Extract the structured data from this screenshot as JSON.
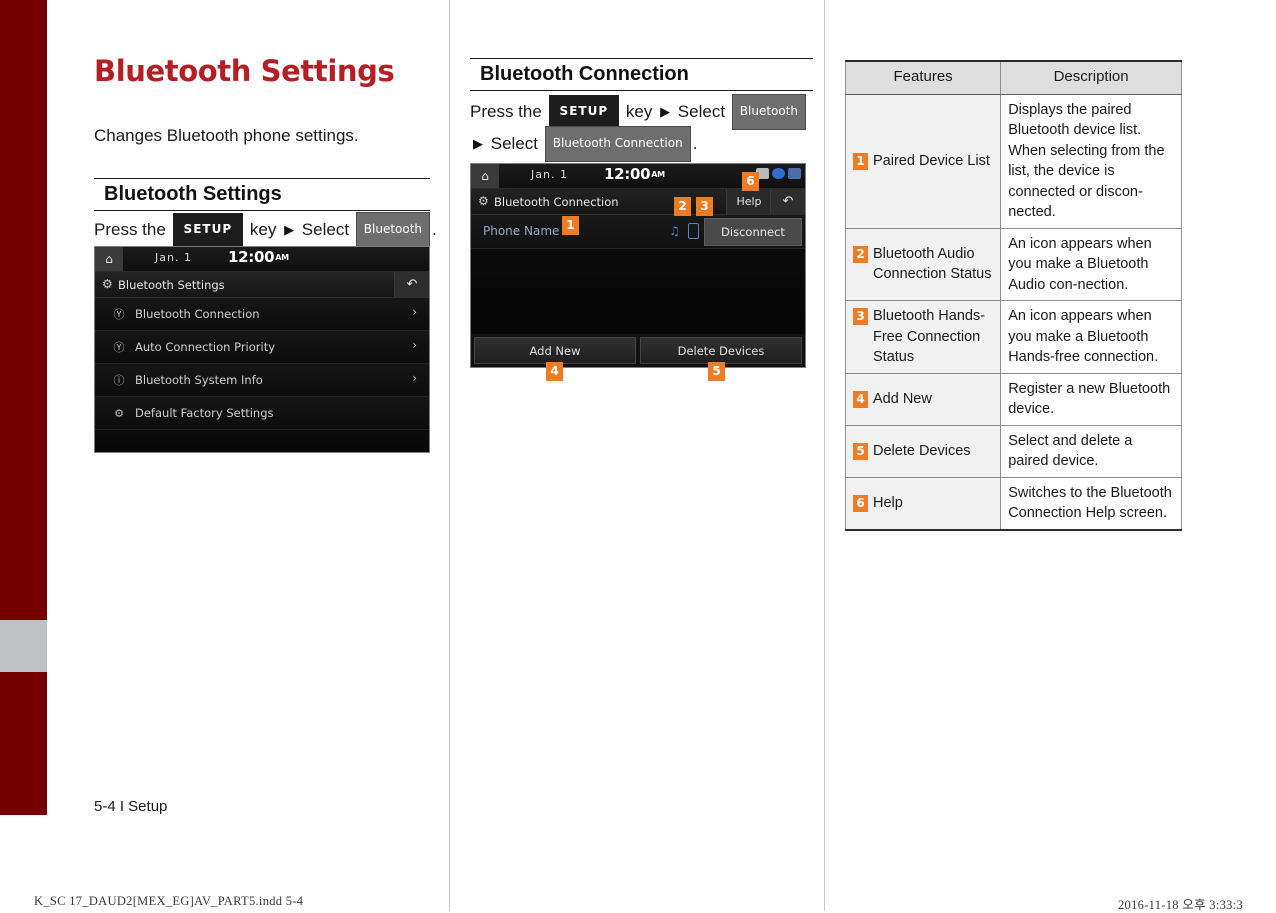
{
  "chapter": {
    "title": "Bluetooth Settings",
    "intro": "Changes Bluetooth phone settings."
  },
  "sections": {
    "left": {
      "heading": "Bluetooth Settings",
      "instruction": {
        "press_the": "Press the",
        "setup_key": "SETUP",
        "key_word": "key",
        "select_word": "Select",
        "target": "Bluetooth",
        "period": "."
      }
    },
    "mid": {
      "heading": "Bluetooth Connection",
      "instruction_line1": {
        "press_the": "Press the",
        "setup_key": "SETUP",
        "key_word": "key",
        "select_word": "Select",
        "target": "Bluetooth"
      },
      "instruction_line2": {
        "select_word": "Select",
        "target": "Bluetooth Connection",
        "period": "."
      }
    }
  },
  "screen_left": {
    "status": {
      "date": "Jan.  1",
      "time": "12:00",
      "ampm": "AM",
      "home_icon": "home-icon"
    },
    "titlebar": {
      "gear_icon": "gear-icon",
      "title": "Bluetooth Settings",
      "back_icon": "back-arrow-icon"
    },
    "rows": [
      {
        "icon": "bluetooth-connection-icon",
        "label": "Bluetooth Connection",
        "chevron": "›"
      },
      {
        "icon": "bluetooth-priority-icon",
        "label": "Auto Connection Priority",
        "chevron": "›"
      },
      {
        "icon": "info-icon",
        "label": "Bluetooth System Info",
        "chevron": "›"
      },
      {
        "icon": "gear-icon",
        "label": "Default Factory Settings",
        "chevron": ""
      }
    ]
  },
  "screen_mid": {
    "status": {
      "date": "Jan.  1",
      "time": "12:00",
      "ampm": "AM",
      "home_icon": "home-icon"
    },
    "titlebar": {
      "gear_icon": "gear-icon",
      "title": "Bluetooth Connection",
      "help_label": "Help",
      "back_icon": "back-arrow-icon"
    },
    "device_row": {
      "name": "Phone Name",
      "audio_icon": "bluetooth-audio-icon",
      "handsfree_icon": "bluetooth-phone-icon",
      "disconnect_label": "Disconnect"
    },
    "footer_buttons": [
      {
        "label": "Add New"
      },
      {
        "label": "Delete Devices"
      }
    ]
  },
  "callouts": {
    "n1": "1",
    "n2": "2",
    "n3": "3",
    "n4": "4",
    "n5": "5",
    "n6": "6"
  },
  "table": {
    "headers": {
      "features": "Features",
      "description": "Description"
    },
    "rows": [
      {
        "num": "1",
        "feature": "Paired Device List",
        "description": "Displays the paired Bluetooth device list. When selecting from the list, the device is connected or discon-nected."
      },
      {
        "num": "2",
        "feature": "Bluetooth Audio Connection Status",
        "description": "An icon appears when you make a Bluetooth Audio con-nection."
      },
      {
        "num": "3",
        "feature": "Bluetooth Hands-Free Connection Status",
        "description": "An icon appears when you make a Bluetooth Hands-free connection."
      },
      {
        "num": "4",
        "feature": "Add New",
        "description": "Register a new Bluetooth device."
      },
      {
        "num": "5",
        "feature": "Delete Devices",
        "description": "Select and delete a paired device."
      },
      {
        "num": "6",
        "feature": "Help",
        "description": "Switches to the Bluetooth Connection Help screen."
      }
    ]
  },
  "footer": {
    "page": "5-4 I Setup",
    "print_file": "K_SC 17_DAUD2[MEX_EG]AV_PART5.indd   5-4",
    "print_date": "2016-11-18   오후 3:33:3"
  },
  "colors": {
    "accent_red": "#b41f24",
    "spine_red": "#760000",
    "spine_gray": "#bfc0c2",
    "badge_orange": "#ef7b23"
  }
}
